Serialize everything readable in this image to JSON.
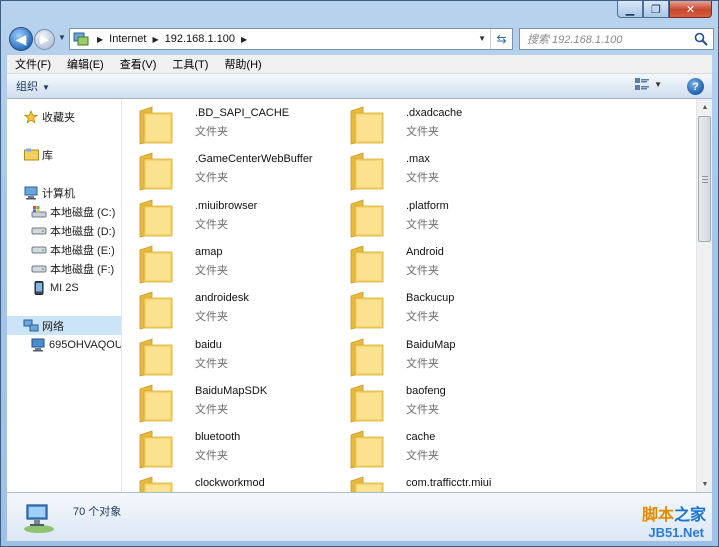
{
  "window": {
    "caption": {
      "minimize_glyph": "▁",
      "maximize_glyph": "❐",
      "close_glyph": "✕"
    }
  },
  "address": {
    "crumbs": [
      "Internet",
      "192.168.1.100"
    ],
    "search_placeholder": "搜索 192.168.1.100"
  },
  "menu": [
    "文件(F)",
    "编辑(E)",
    "查看(V)",
    "工具(T)",
    "帮助(H)"
  ],
  "toolbar": {
    "organize_label": "组织",
    "help_label": "?"
  },
  "nav": {
    "favorites": "收藏夹",
    "libraries": "库",
    "computer": "计算机",
    "drives": [
      "本地磁盘 (C:)",
      "本地磁盘 (D:)",
      "本地磁盘 (E:)",
      "本地磁盘 (F:)",
      "MI 2S"
    ],
    "network": "网络",
    "network_host": "695OHVAQOU"
  },
  "files": [
    {
      "name": ".BD_SAPI_CACHE",
      "type": "文件夹"
    },
    {
      "name": ".dxadcache",
      "type": "文件夹"
    },
    {
      "name": ".GameCenterWebBuffer",
      "type": "文件夹"
    },
    {
      "name": ".max",
      "type": "文件夹"
    },
    {
      "name": ".miuibrowser",
      "type": "文件夹"
    },
    {
      "name": ".platform",
      "type": "文件夹"
    },
    {
      "name": "amap",
      "type": "文件夹"
    },
    {
      "name": "Android",
      "type": "文件夹"
    },
    {
      "name": "androidesk",
      "type": "文件夹"
    },
    {
      "name": "Backucup",
      "type": "文件夹"
    },
    {
      "name": "baidu",
      "type": "文件夹"
    },
    {
      "name": "BaiduMap",
      "type": "文件夹"
    },
    {
      "name": "BaiduMapSDK",
      "type": "文件夹"
    },
    {
      "name": "baofeng",
      "type": "文件夹"
    },
    {
      "name": "bluetooth",
      "type": "文件夹"
    },
    {
      "name": "cache",
      "type": "文件夹"
    },
    {
      "name": "clockworkmod",
      "type": ""
    },
    {
      "name": "com.trafficctr.miui",
      "type": ""
    }
  ],
  "status": {
    "count_text": "70 个对象"
  },
  "watermark": {
    "text_a": "脚本",
    "text_b": "之家",
    "url": "JB51.Net"
  },
  "colors": {
    "folder": "#f4cf5b",
    "accent": "#1a75c9"
  }
}
